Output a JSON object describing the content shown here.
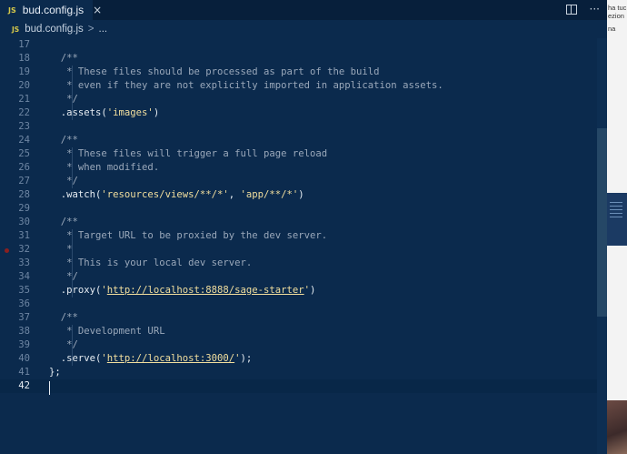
{
  "tab": {
    "icon": "JS",
    "filename": "bud.config.js",
    "close": "×"
  },
  "toolbar": {
    "more": "···"
  },
  "breadcrumb": {
    "icon": "JS",
    "file": "bud.config.js",
    "separator": ">",
    "rest": "..."
  },
  "editor": {
    "lines": [
      {
        "n": "17",
        "code": ""
      },
      {
        "n": "18",
        "code": "/**"
      },
      {
        "n": "19",
        "code": " * These files should be processed as part of the build"
      },
      {
        "n": "20",
        "code": " * even if they are not explicitly imported in application assets."
      },
      {
        "n": "21",
        "code": " */"
      },
      {
        "n": "22",
        "code": ".assets('images')"
      },
      {
        "n": "23",
        "code": ""
      },
      {
        "n": "24",
        "code": "/**"
      },
      {
        "n": "25",
        "code": " * These files will trigger a full page reload"
      },
      {
        "n": "26",
        "code": " * when modified."
      },
      {
        "n": "27",
        "code": " */"
      },
      {
        "n": "28",
        "code": ".watch('resources/views/**/*', 'app/**/*')"
      },
      {
        "n": "29",
        "code": ""
      },
      {
        "n": "30",
        "code": "/**"
      },
      {
        "n": "31",
        "code": " * Target URL to be proxied by the dev server."
      },
      {
        "n": "32",
        "code": " *"
      },
      {
        "n": "33",
        "code": " * This is your local dev server."
      },
      {
        "n": "34",
        "code": " */"
      },
      {
        "n": "35",
        "code": ".proxy('http://localhost:8888/sage-starter')"
      },
      {
        "n": "36",
        "code": ""
      },
      {
        "n": "37",
        "code": "/**"
      },
      {
        "n": "38",
        "code": " * Development URL"
      },
      {
        "n": "39",
        "code": " */"
      },
      {
        "n": "40",
        "code": ".serve('http://localhost:3000/');"
      },
      {
        "n": "41",
        "code": "};"
      },
      {
        "n": "42",
        "code": ""
      }
    ]
  },
  "strip": {
    "lines": [
      "ha tuc",
      "ezion",
      "na"
    ]
  },
  "colors": {
    "background": "#0b2a4d",
    "comment": "#9aa8ba",
    "string": "#f2df9e",
    "js_badge": "#d7c94a"
  }
}
